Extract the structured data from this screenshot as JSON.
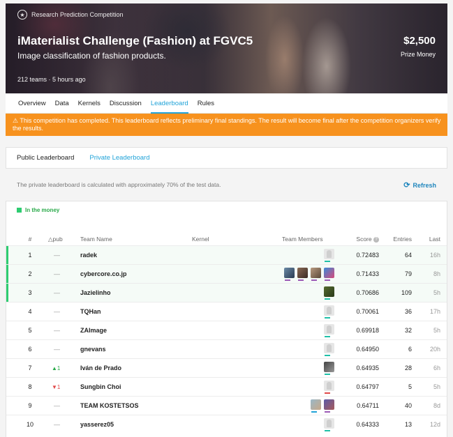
{
  "hero": {
    "category": "Research Prediction Competition",
    "title": "iMaterialist Challenge (Fashion) at FGVC5",
    "subtitle": "Image classification of fashion products.",
    "teams": "212 teams",
    "time": "5 hours ago",
    "prize_amount": "$2,500",
    "prize_label": "Prize Money"
  },
  "tabs": [
    "Overview",
    "Data",
    "Kernels",
    "Discussion",
    "Leaderboard",
    "Rules"
  ],
  "alert": "⚠ This competition has completed. This leaderboard reflects preliminary final standings. The result will become final after the competition organizers verify the results.",
  "leaderboard_tabs": [
    "Public Leaderboard",
    "Private Leaderboard"
  ],
  "note": "The private leaderboard is calculated with approximately 70% of the test data.",
  "refresh_label": "Refresh",
  "money_label": "In the money",
  "columns": {
    "rank": "#",
    "pub": "△pub",
    "team": "Team Name",
    "kernel": "Kernel",
    "members": "Team Members",
    "score": "Score",
    "entries": "Entries",
    "last": "Last"
  },
  "rows": [
    {
      "rank": "1",
      "pub": "—",
      "team": "radek",
      "score": "0.72483",
      "entries": "64",
      "last": "16h",
      "money": true
    },
    {
      "rank": "2",
      "pub": "—",
      "team": "cybercore.co.jp",
      "score": "0.71433",
      "entries": "79",
      "last": "8h",
      "money": true
    },
    {
      "rank": "3",
      "pub": "—",
      "team": "Jazielinho",
      "score": "0.70686",
      "entries": "109",
      "last": "5h",
      "money": true
    },
    {
      "rank": "4",
      "pub": "—",
      "team": "TQHan",
      "score": "0.70061",
      "entries": "36",
      "last": "17h"
    },
    {
      "rank": "5",
      "pub": "—",
      "team": "ZAImage",
      "score": "0.69918",
      "entries": "32",
      "last": "5h"
    },
    {
      "rank": "6",
      "pub": "—",
      "team": "gnevans",
      "score": "0.64950",
      "entries": "6",
      "last": "20h"
    },
    {
      "rank": "7",
      "pub": "▲1",
      "team": "Iván de Prado",
      "score": "0.64935",
      "entries": "28",
      "last": "6h"
    },
    {
      "rank": "8",
      "pub": "▼1",
      "team": "Sungbin Choi",
      "score": "0.64797",
      "entries": "5",
      "last": "5h"
    },
    {
      "rank": "9",
      "pub": "—",
      "team": "TEAM KOSTETSOS",
      "score": "0.64711",
      "entries": "40",
      "last": "8d"
    },
    {
      "rank": "10",
      "pub": "—",
      "team": "yasserez05",
      "score": "0.64333",
      "entries": "13",
      "last": "12d"
    }
  ]
}
